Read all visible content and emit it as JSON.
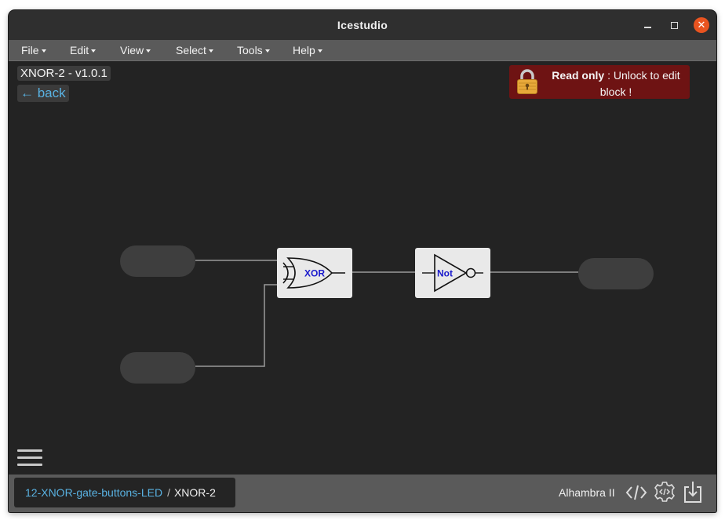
{
  "window": {
    "title": "Icestudio"
  },
  "menu": [
    {
      "label": "File"
    },
    {
      "label": "Edit"
    },
    {
      "label": "View"
    },
    {
      "label": "Select"
    },
    {
      "label": "Tools"
    },
    {
      "label": "Help"
    }
  ],
  "canvas": {
    "version_label": "XNOR-2 - v1.0.1",
    "back_label": "← back",
    "readonly": {
      "strong": "Read only",
      "separator": " : ",
      "message": "Unlock to edit block !"
    },
    "xor_gate_label": "XOR",
    "not_gate_label": "Not"
  },
  "statusbar": {
    "breadcrumb_parent": "12-XNOR-gate-buttons-LED",
    "breadcrumb_separator": "/",
    "breadcrumb_current": "XNOR-2",
    "board": "Alhambra II"
  },
  "colors": {
    "background": "#232323",
    "menubar": "#5a5a5a",
    "link": "#59b2e2",
    "readonly_banner": "#6e1313",
    "close_button": "#e95420",
    "gate_label": "#1a1acc",
    "wire": "#9a9a9a"
  },
  "icons": {
    "lock": "lock-icon",
    "code": "code-icon",
    "settings": "gear-code-icon",
    "download": "download-icon",
    "menu": "hamburger-icon"
  }
}
